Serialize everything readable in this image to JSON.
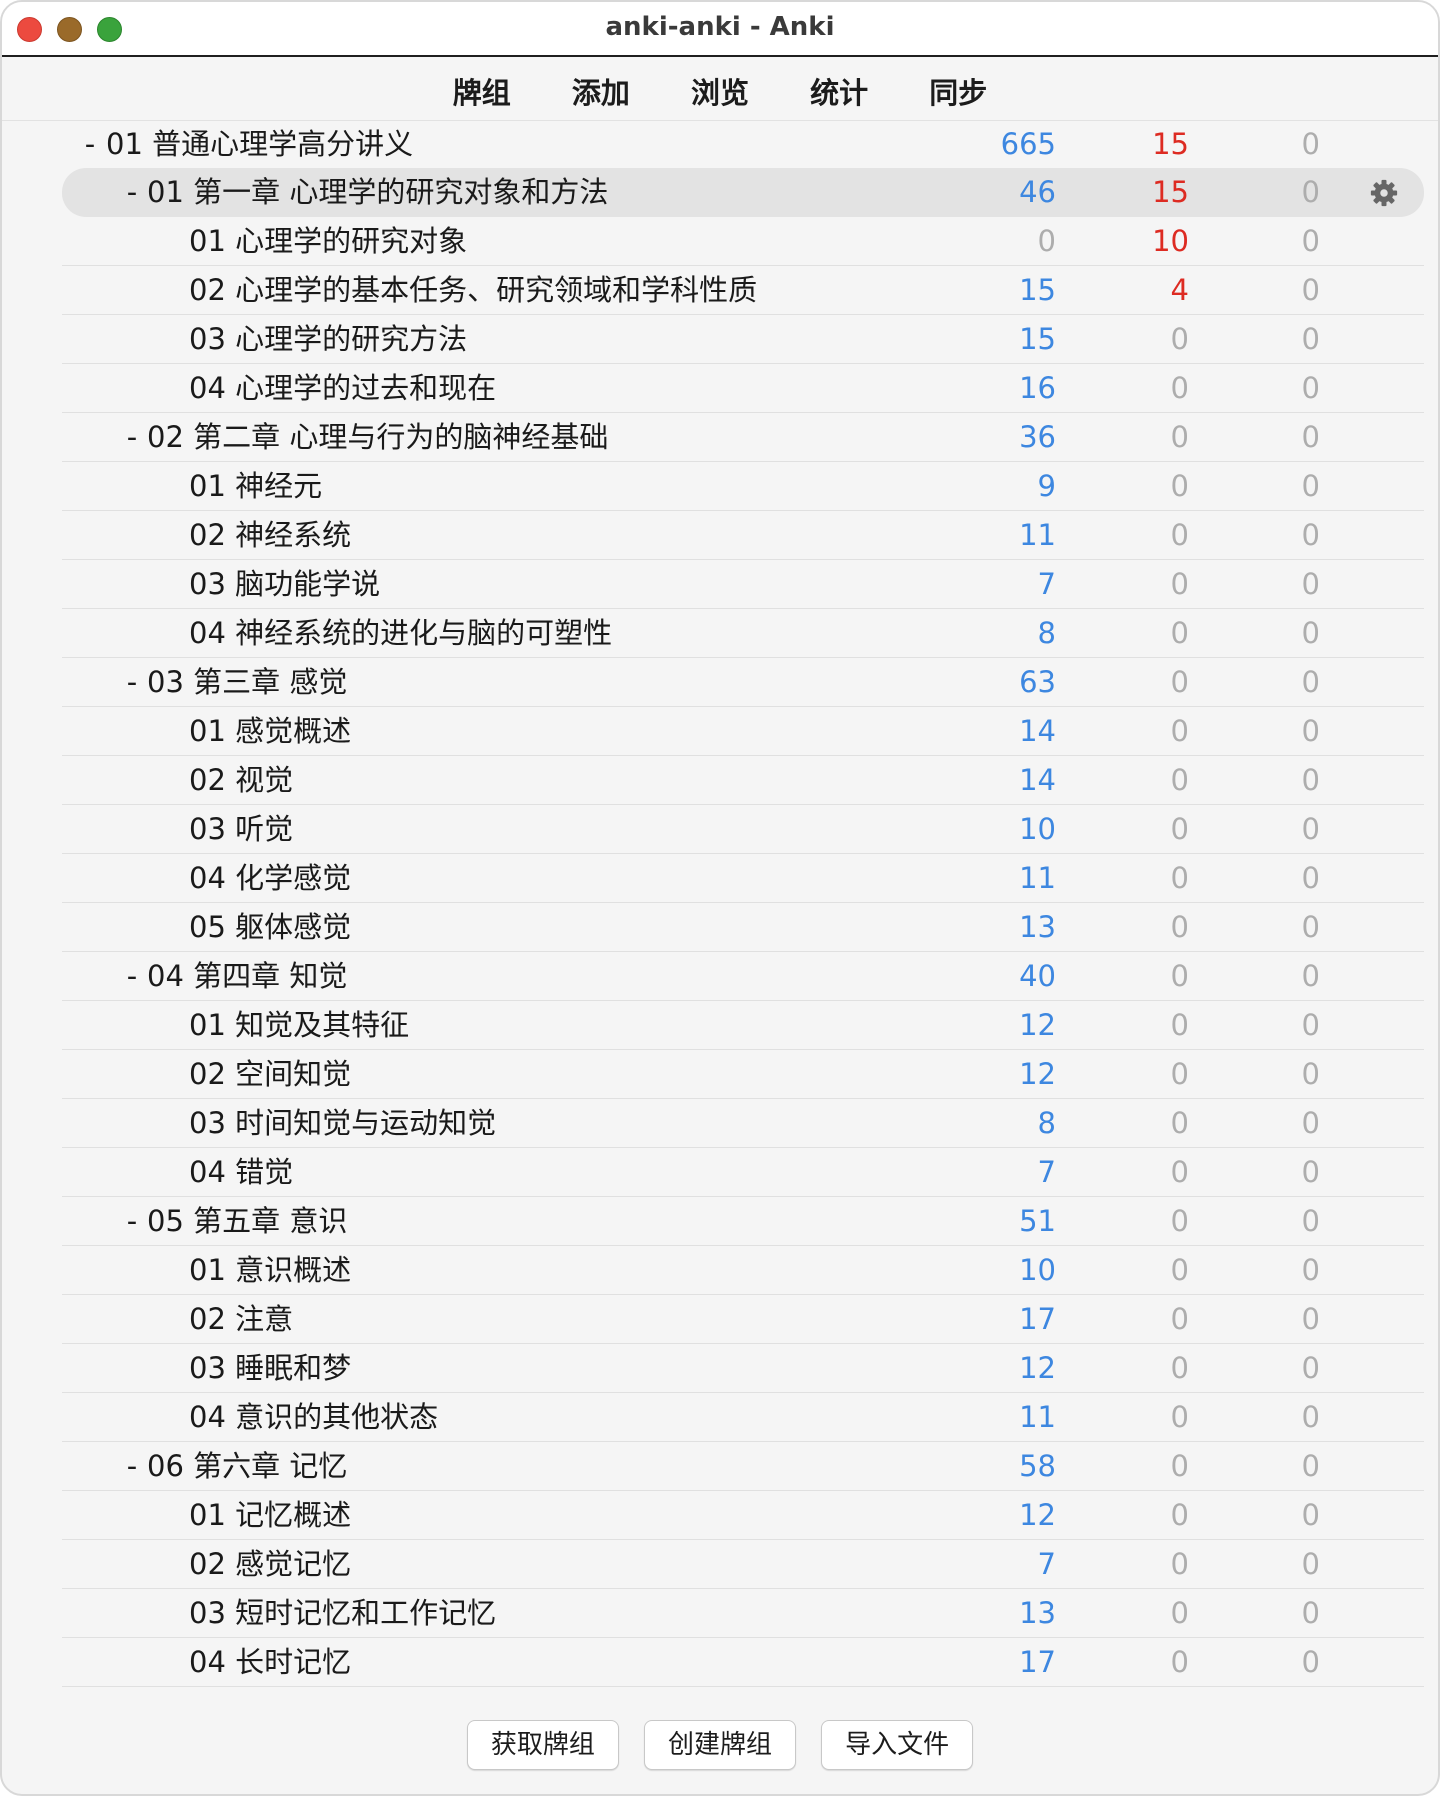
{
  "window": {
    "title": "anki-anki - Anki"
  },
  "toolbar": {
    "items": [
      "牌组",
      "添加",
      "浏览",
      "统计",
      "同步"
    ]
  },
  "colors": {
    "new": "#3d87e0",
    "learn": "#dd2b22",
    "zero": "#adadad"
  },
  "decks": [
    {
      "toggle": "-",
      "name": "01 普通心理学高分讲义",
      "level": 0,
      "new": "665",
      "learn": "15",
      "due": "0"
    },
    {
      "toggle": "-",
      "name": "01 第一章 心理学的研究对象和方法",
      "level": 1,
      "new": "46",
      "learn": "15",
      "due": "0",
      "selected": true,
      "gear": "gear-icon"
    },
    {
      "toggle": "",
      "name": "01 心理学的研究对象",
      "level": 2,
      "new": "0",
      "learn": "10",
      "due": "0"
    },
    {
      "toggle": "",
      "name": "02 心理学的基本任务、研究领域和学科性质",
      "level": 2,
      "new": "15",
      "learn": "4",
      "due": "0"
    },
    {
      "toggle": "",
      "name": "03 心理学的研究方法",
      "level": 2,
      "new": "15",
      "learn": "0",
      "due": "0"
    },
    {
      "toggle": "",
      "name": "04 心理学的过去和现在",
      "level": 2,
      "new": "16",
      "learn": "0",
      "due": "0"
    },
    {
      "toggle": "-",
      "name": "02 第二章 心理与行为的脑神经基础",
      "level": 1,
      "new": "36",
      "learn": "0",
      "due": "0"
    },
    {
      "toggle": "",
      "name": "01 神经元",
      "level": 2,
      "new": "9",
      "learn": "0",
      "due": "0"
    },
    {
      "toggle": "",
      "name": "02 神经系统",
      "level": 2,
      "new": "11",
      "learn": "0",
      "due": "0"
    },
    {
      "toggle": "",
      "name": "03 脑功能学说",
      "level": 2,
      "new": "7",
      "learn": "0",
      "due": "0"
    },
    {
      "toggle": "",
      "name": "04 神经系统的进化与脑的可塑性",
      "level": 2,
      "new": "8",
      "learn": "0",
      "due": "0"
    },
    {
      "toggle": "-",
      "name": "03 第三章 感觉",
      "level": 1,
      "new": "63",
      "learn": "0",
      "due": "0"
    },
    {
      "toggle": "",
      "name": "01 感觉概述",
      "level": 2,
      "new": "14",
      "learn": "0",
      "due": "0"
    },
    {
      "toggle": "",
      "name": "02 视觉",
      "level": 2,
      "new": "14",
      "learn": "0",
      "due": "0"
    },
    {
      "toggle": "",
      "name": "03 听觉",
      "level": 2,
      "new": "10",
      "learn": "0",
      "due": "0"
    },
    {
      "toggle": "",
      "name": "04 化学感觉",
      "level": 2,
      "new": "11",
      "learn": "0",
      "due": "0"
    },
    {
      "toggle": "",
      "name": "05 躯体感觉",
      "level": 2,
      "new": "13",
      "learn": "0",
      "due": "0"
    },
    {
      "toggle": "-",
      "name": "04 第四章 知觉",
      "level": 1,
      "new": "40",
      "learn": "0",
      "due": "0"
    },
    {
      "toggle": "",
      "name": "01 知觉及其特征",
      "level": 2,
      "new": "12",
      "learn": "0",
      "due": "0"
    },
    {
      "toggle": "",
      "name": "02 空间知觉",
      "level": 2,
      "new": "12",
      "learn": "0",
      "due": "0"
    },
    {
      "toggle": "",
      "name": "03 时间知觉与运动知觉",
      "level": 2,
      "new": "8",
      "learn": "0",
      "due": "0"
    },
    {
      "toggle": "",
      "name": "04 错觉",
      "level": 2,
      "new": "7",
      "learn": "0",
      "due": "0"
    },
    {
      "toggle": "-",
      "name": "05 第五章 意识",
      "level": 1,
      "new": "51",
      "learn": "0",
      "due": "0"
    },
    {
      "toggle": "",
      "name": "01 意识概述",
      "level": 2,
      "new": "10",
      "learn": "0",
      "due": "0"
    },
    {
      "toggle": "",
      "name": "02 注意",
      "level": 2,
      "new": "17",
      "learn": "0",
      "due": "0"
    },
    {
      "toggle": "",
      "name": "03 睡眠和梦",
      "level": 2,
      "new": "12",
      "learn": "0",
      "due": "0"
    },
    {
      "toggle": "",
      "name": "04 意识的其他状态",
      "level": 2,
      "new": "11",
      "learn": "0",
      "due": "0"
    },
    {
      "toggle": "-",
      "name": "06 第六章 记忆",
      "level": 1,
      "new": "58",
      "learn": "0",
      "due": "0"
    },
    {
      "toggle": "",
      "name": "01 记忆概述",
      "level": 2,
      "new": "12",
      "learn": "0",
      "due": "0"
    },
    {
      "toggle": "",
      "name": "02 感觉记忆",
      "level": 2,
      "new": "7",
      "learn": "0",
      "due": "0"
    },
    {
      "toggle": "",
      "name": "03 短时记忆和工作记忆",
      "level": 2,
      "new": "13",
      "learn": "0",
      "due": "0"
    },
    {
      "toggle": "",
      "name": "04 长时记忆",
      "level": 2,
      "new": "17",
      "learn": "0",
      "due": "0"
    }
  ],
  "bottom_buttons": [
    "获取牌组",
    "创建牌组",
    "导入文件"
  ]
}
